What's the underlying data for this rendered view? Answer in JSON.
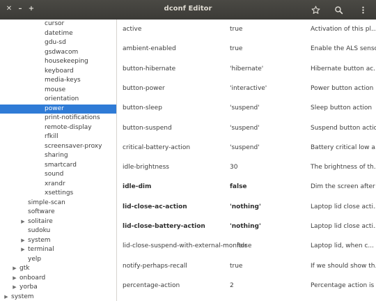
{
  "window": {
    "title": "dconf Editor",
    "controls": {
      "close": "✕",
      "minimize": "–",
      "maximize": "+"
    }
  },
  "header": {
    "icons": [
      "star-icon",
      "search-icon",
      "menu-icon"
    ]
  },
  "sidebar": {
    "items": [
      {
        "label": "cursor",
        "level": 3,
        "expander": ""
      },
      {
        "label": "datetime",
        "level": 3,
        "expander": ""
      },
      {
        "label": "gdu-sd",
        "level": 3,
        "expander": ""
      },
      {
        "label": "gsdwacom",
        "level": 3,
        "expander": ""
      },
      {
        "label": "housekeeping",
        "level": 3,
        "expander": ""
      },
      {
        "label": "keyboard",
        "level": 3,
        "expander": ""
      },
      {
        "label": "media-keys",
        "level": 3,
        "expander": ""
      },
      {
        "label": "mouse",
        "level": 3,
        "expander": ""
      },
      {
        "label": "orientation",
        "level": 3,
        "expander": ""
      },
      {
        "label": "power",
        "level": 3,
        "expander": "",
        "selected": true
      },
      {
        "label": "print-notifications",
        "level": 3,
        "expander": ""
      },
      {
        "label": "remote-display",
        "level": 3,
        "expander": ""
      },
      {
        "label": "rfkill",
        "level": 3,
        "expander": ""
      },
      {
        "label": "screensaver-proxy",
        "level": 3,
        "expander": ""
      },
      {
        "label": "sharing",
        "level": 3,
        "expander": ""
      },
      {
        "label": "smartcard",
        "level": 3,
        "expander": ""
      },
      {
        "label": "sound",
        "level": 3,
        "expander": ""
      },
      {
        "label": "xrandr",
        "level": 3,
        "expander": ""
      },
      {
        "label": "xsettings",
        "level": 3,
        "expander": ""
      },
      {
        "label": "simple-scan",
        "level": 2,
        "expander": ""
      },
      {
        "label": "software",
        "level": 2,
        "expander": ""
      },
      {
        "label": "solitaire",
        "level": 2,
        "expander": "▶"
      },
      {
        "label": "sudoku",
        "level": 2,
        "expander": ""
      },
      {
        "label": "system",
        "level": 2,
        "expander": "▶"
      },
      {
        "label": "terminal",
        "level": 2,
        "expander": "▶"
      },
      {
        "label": "yelp",
        "level": 2,
        "expander": ""
      },
      {
        "label": "gtk",
        "level": 1,
        "expander": "▶"
      },
      {
        "label": "onboard",
        "level": 1,
        "expander": "▶"
      },
      {
        "label": "yorba",
        "level": 1,
        "expander": "▶"
      },
      {
        "label": "system",
        "level": 0,
        "expander": "▶"
      }
    ]
  },
  "keys": [
    {
      "name": "active",
      "value": "true",
      "description": "Activation of this pl...",
      "modified": false
    },
    {
      "name": "ambient-enabled",
      "value": "true",
      "description": "Enable the ALS sensor",
      "modified": false
    },
    {
      "name": "button-hibernate",
      "value": "'hibernate'",
      "description": "Hibernate button ac...",
      "modified": false
    },
    {
      "name": "button-power",
      "value": "'interactive'",
      "description": "Power button action",
      "modified": false
    },
    {
      "name": "button-sleep",
      "value": "'suspend'",
      "description": "Sleep button action",
      "modified": false
    },
    {
      "name": "button-suspend",
      "value": "'suspend'",
      "description": "Suspend button action",
      "modified": false
    },
    {
      "name": "critical-battery-action",
      "value": "'suspend'",
      "description": "Battery critical low a...",
      "modified": false
    },
    {
      "name": "idle-brightness",
      "value": "30",
      "description": "The brightness of th...",
      "modified": false
    },
    {
      "name": "idle-dim",
      "value": "false",
      "description": "Dim the screen after ...",
      "modified": true
    },
    {
      "name": "lid-close-ac-action",
      "value": "'nothing'",
      "description": "Laptop lid close acti...",
      "modified": true
    },
    {
      "name": "lid-close-battery-action",
      "value": "'nothing'",
      "description": "Laptop lid close acti...",
      "modified": true
    },
    {
      "name": "lid-close-suspend-with-external-monitor",
      "value": "false",
      "description": "Laptop lid, when c...",
      "modified": false
    },
    {
      "name": "notify-perhaps-recall",
      "value": "true",
      "description": "If we should show th...",
      "modified": false
    },
    {
      "name": "percentage-action",
      "value": "2",
      "description": "Percentage action is ...",
      "modified": false
    }
  ]
}
